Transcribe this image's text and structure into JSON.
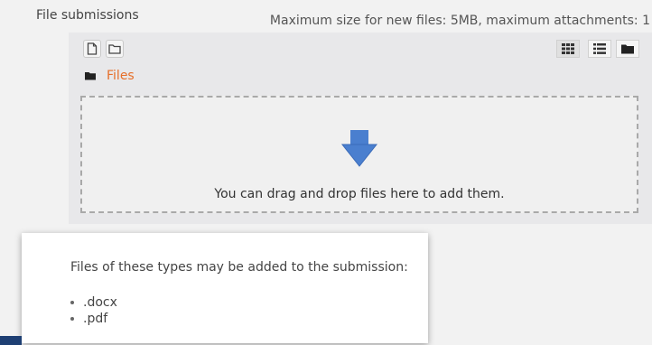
{
  "field": {
    "label": "File submissions",
    "max_size_text": "Maximum size for new files: 5MB, maximum attachments: 1"
  },
  "toolbar": {
    "add_file_icon": "file-icon",
    "create_folder_icon": "folder-icon",
    "view_modes": [
      "icons-view",
      "list-view",
      "tree-view"
    ],
    "active_view": "icons-view"
  },
  "path": {
    "folder_icon": "folder-icon",
    "label": "Files"
  },
  "dropzone": {
    "text": "You can drag and drop files here to add them.",
    "arrow_color": "#4a7fcf"
  },
  "tooltip": {
    "text": "Files of these types may be added to the submission:",
    "types": [
      ".docx",
      ".pdf"
    ]
  },
  "colors": {
    "link": "#e66f2a",
    "dropzone_border": "#a9a9a9"
  }
}
